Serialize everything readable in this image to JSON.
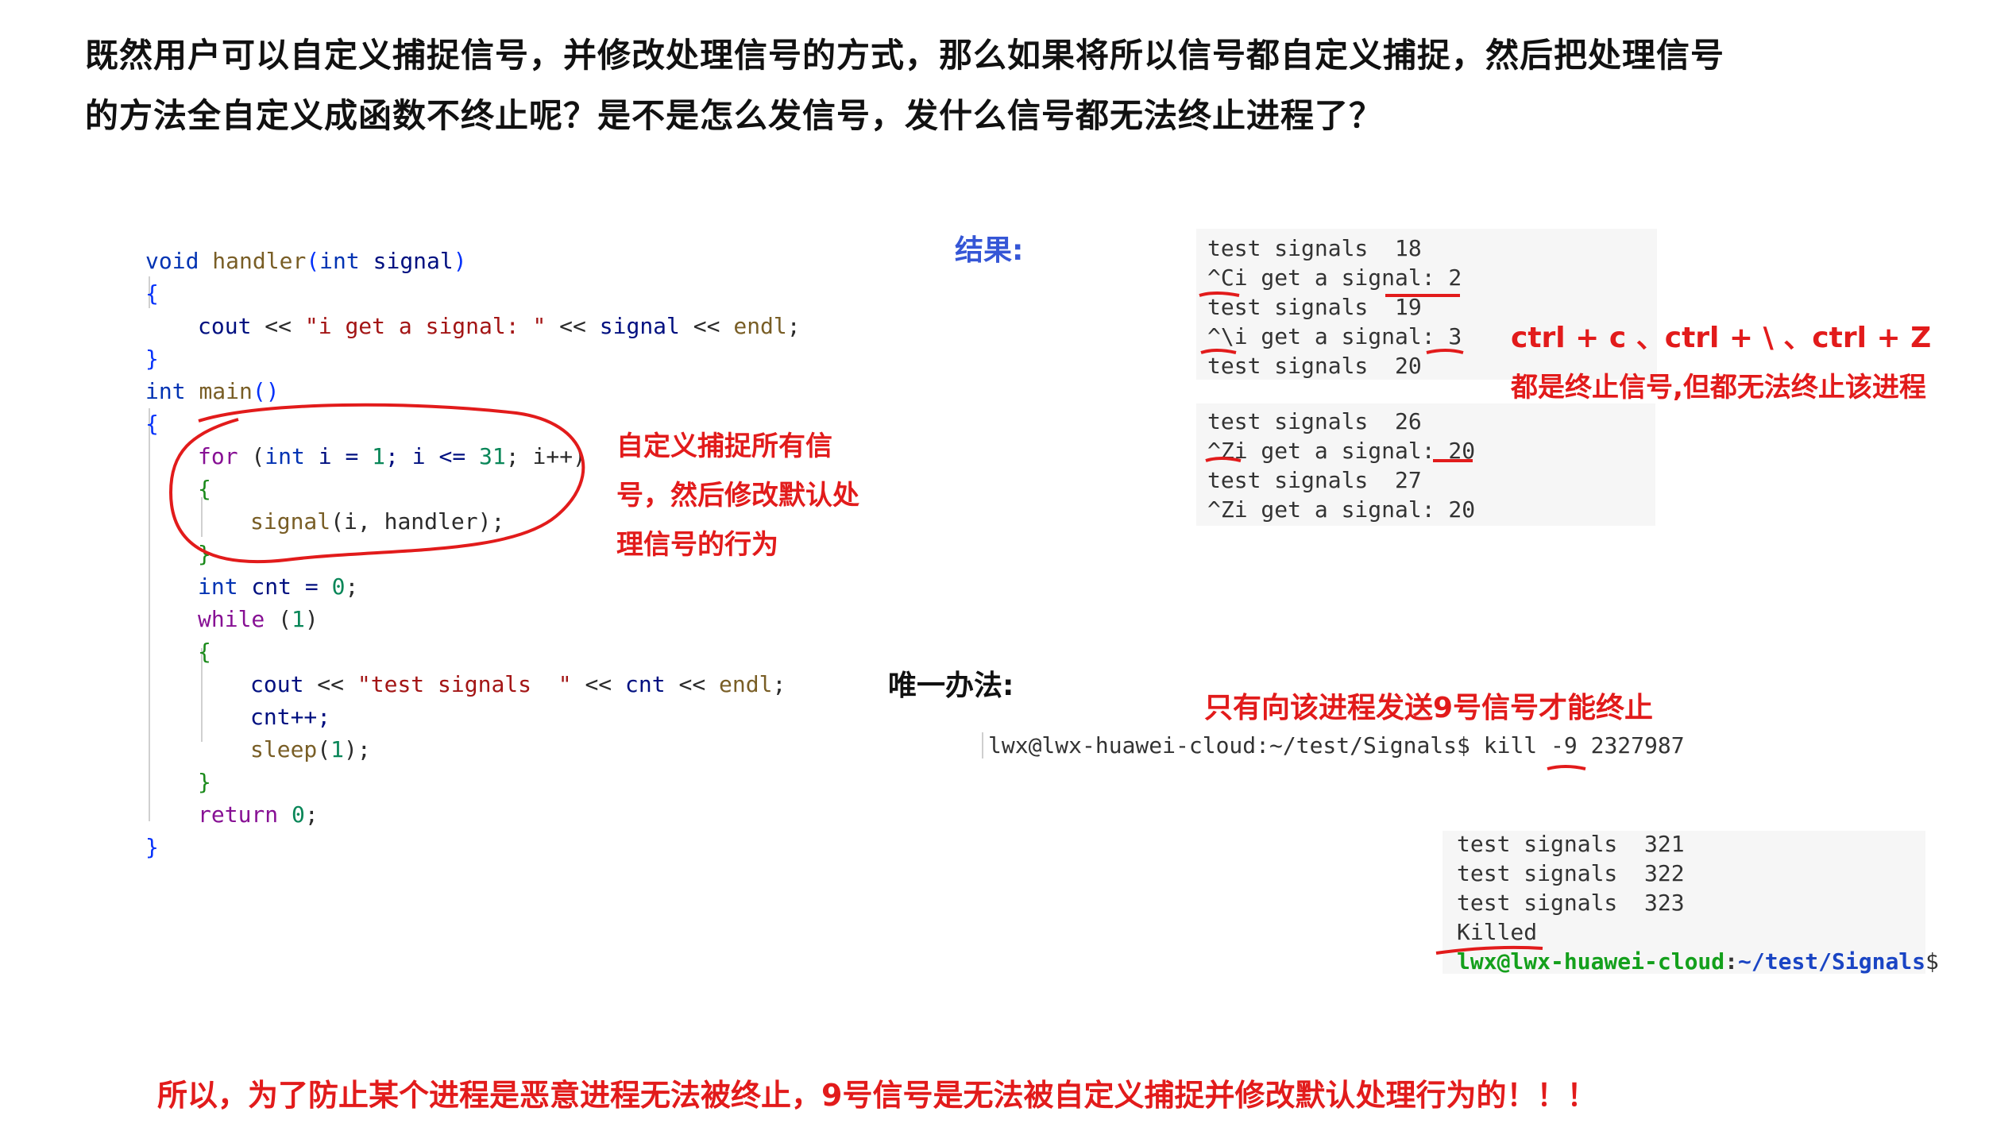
{
  "heading": {
    "line1": "既然用户可以自定义捕捉信号，并修改处理信号的方式，那么如果将所以信号都自定义捕捉，然后把处理信号",
    "line2": "的方法全自定义成函数不终止呢？是不是怎么发信号，发什么信号都无法终止进程了？"
  },
  "code": {
    "l1_type": "void",
    "l1_fn": "handler",
    "l1_paren_open": "(",
    "l1_ptype": "int",
    "l1_param": "signal",
    "l1_paren_close": ")",
    "l2": "{",
    "l3_cout": "cout",
    "l3_op1": " << ",
    "l3_str": "\"i get a signal: \"",
    "l3_op2": " << ",
    "l3_var": "signal",
    "l3_op3": " << ",
    "l3_endl": "endl",
    "l3_semi": ";",
    "l4": "}",
    "l5_type": "int",
    "l5_fn": "main",
    "l5_paren": "()",
    "l6": "{",
    "l7_for": "for",
    "l7_a": " (",
    "l7_int": "int",
    "l7_b": " i = ",
    "l7_one": "1",
    "l7_c": "; i <= ",
    "l7_31": "31",
    "l7_d": "; i++)",
    "l8": "{",
    "l9_fn": "signal",
    "l9_args": "(i, handler);",
    "l10": "}",
    "l11_int": "int",
    "l11_rest": " cnt = ",
    "l11_zero": "0",
    "l11_semi": ";",
    "l12_while": "while",
    "l12_rest": " (",
    "l12_one": "1",
    "l12_close": ")",
    "l13": "{",
    "l14_cout": "cout",
    "l14_op1": " << ",
    "l14_str": "\"test signals  \"",
    "l14_op2": " << ",
    "l14_var": "cnt",
    "l14_op3": " << ",
    "l14_endl": "endl",
    "l14_semi": ";",
    "l15": "cnt++;",
    "l16_fn": "sleep",
    "l16_a": "(",
    "l16_one": "1",
    "l16_b": ");",
    "l17": "}",
    "l18_ret": "return",
    "l18_sp": " ",
    "l18_zero": "0",
    "l18_semi": ";",
    "l19": "}"
  },
  "notes": {
    "custom_catch_1": "自定义捕捉所有信",
    "custom_catch_2": "号，然后修改默认处",
    "custom_catch_3": "理信号的行为",
    "result_label": "结果:",
    "ctrl_keys": "ctrl + c 、ctrl + \\ 、ctrl + Z",
    "ctrl_desc": "都是终止信号,但都无法终止该进程",
    "only_way_label": "唯一办法:",
    "only_way_desc": "只有向该进程发送9号信号才能终止",
    "conclusion": "所以，为了防止某个进程是恶意进程无法被终止，9号信号是无法被自定义捕捉并修改默认处理行为的！！！"
  },
  "terminal1": [
    "test signals  18",
    "^Ci get a signal: 2",
    "test signals  19",
    "^\\i get a signal: 3",
    "test signals  20"
  ],
  "terminal2": [
    "test signals  26",
    "^Zi get a signal: 20",
    "test signals  27",
    "^Zi get a signal: 20"
  ],
  "kill_cmd": "lwx@lwx-huawei-cloud:~/test/Signals$ kill -9 2327987",
  "terminal3": {
    "lines": [
      "test signals  321",
      "test signals  322",
      "test signals  323",
      "Killed"
    ],
    "prompt_user": "lwx@lwx-huawei-cloud",
    "prompt_sep": ":",
    "prompt_path": "~/test/Signals",
    "prompt_end": "$"
  },
  "colors": {
    "accent_red": "#e21b1b",
    "label_blue": "#3556d6",
    "prompt_green": "#14a01c",
    "path_blue": "#1a45c4"
  }
}
